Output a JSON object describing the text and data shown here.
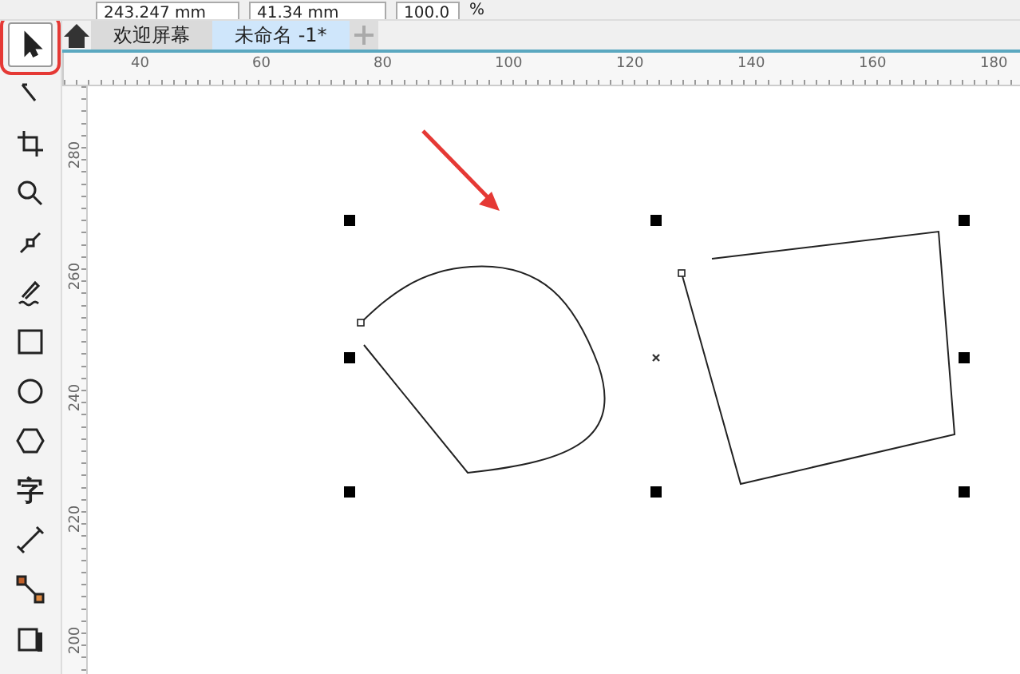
{
  "property_bar": {
    "width": "243.247 mm",
    "height": "41.34 mm",
    "scale": "100.0",
    "unit": "%"
  },
  "tabs": [
    {
      "label": "欢迎屏幕",
      "selected": false
    },
    {
      "label": "未命名 -1*",
      "selected": true
    }
  ],
  "tools": [
    {
      "kind": "pick",
      "selected": true,
      "annotated": true
    },
    {
      "kind": "shape",
      "selected": false,
      "annotated": false
    },
    {
      "kind": "crop",
      "selected": false,
      "annotated": false
    },
    {
      "kind": "zoom",
      "selected": false,
      "annotated": false
    },
    {
      "kind": "curve",
      "selected": false,
      "annotated": false
    },
    {
      "kind": "artistic",
      "selected": false,
      "annotated": false
    },
    {
      "kind": "rectangle",
      "selected": false,
      "annotated": false
    },
    {
      "kind": "ellipse",
      "selected": false,
      "annotated": false
    },
    {
      "kind": "polygon",
      "selected": false,
      "annotated": false
    },
    {
      "kind": "text",
      "label": "字",
      "selected": false,
      "annotated": false
    },
    {
      "kind": "dimension",
      "selected": false,
      "annotated": false
    },
    {
      "kind": "connector",
      "selected": false,
      "annotated": false
    },
    {
      "kind": "shadow",
      "selected": false,
      "annotated": false
    }
  ],
  "horizontal_ruler": [
    "40",
    "60",
    "80",
    "100",
    "120",
    "140",
    "160",
    "180"
  ],
  "vertical_ruler": [
    "280",
    "260",
    "240",
    "220",
    "200"
  ]
}
